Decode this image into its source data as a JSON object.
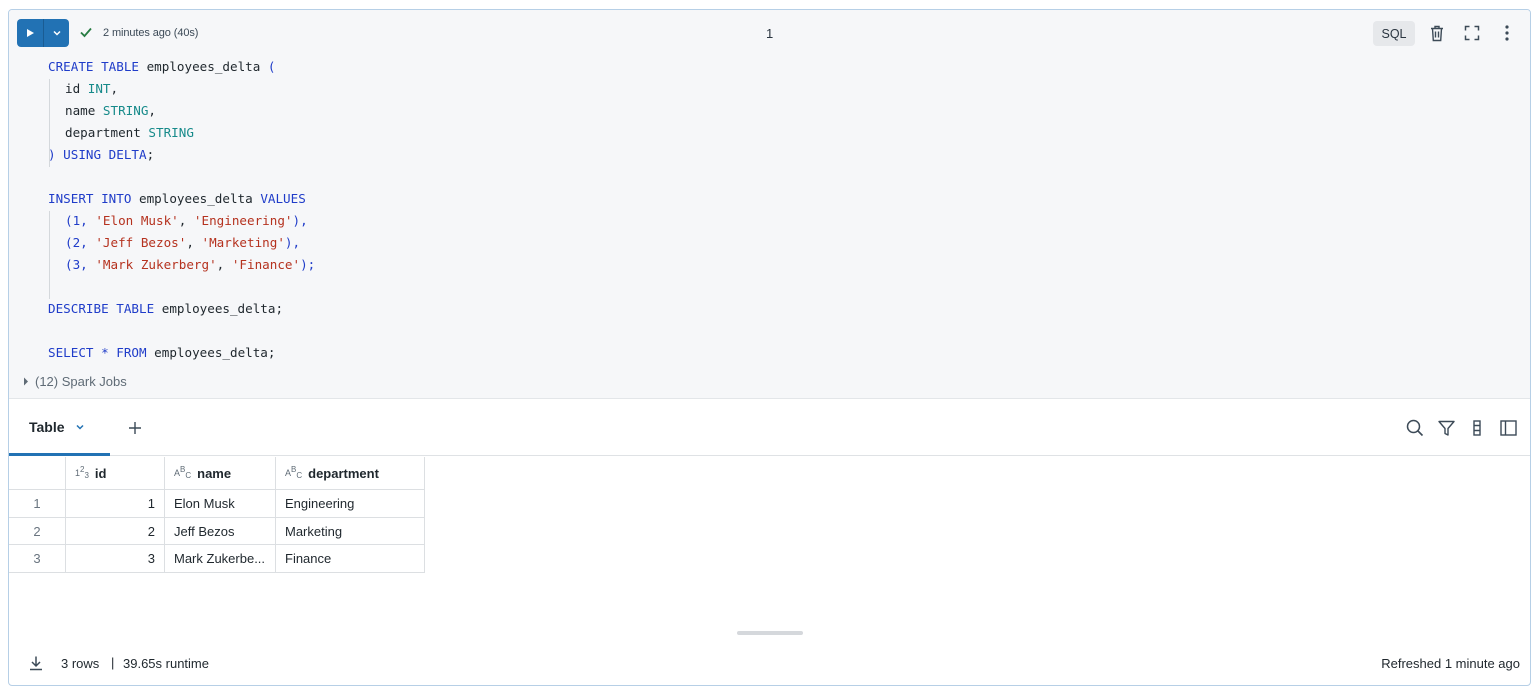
{
  "header": {
    "status_text": "2 minutes ago (40s)",
    "cell_index": "1",
    "language": "SQL"
  },
  "code": {
    "l1": {
      "a": "CREATE TABLE",
      "b": " employees_delta ",
      "c": "("
    },
    "l2": {
      "a": "id ",
      "b": "INT",
      "c": ","
    },
    "l3": {
      "a": "name ",
      "b": "STRING",
      "c": ","
    },
    "l4": {
      "a": "department ",
      "b": "STRING"
    },
    "l5": {
      "a": ")",
      "b": " USING DELTA",
      "c": ";"
    },
    "l6": {
      "a": "INSERT INTO",
      "b": " employees_delta ",
      "c": "VALUES"
    },
    "l7": {
      "a": "(1, ",
      "b": "'Elon Musk'",
      "c": ", ",
      "d": "'Engineering'",
      "e": "),"
    },
    "l8": {
      "a": "(2, ",
      "b": "'Jeff Bezos'",
      "c": ", ",
      "d": "'Marketing'",
      "e": "),"
    },
    "l9": {
      "a": "(3, ",
      "b": "'Mark Zukerberg'",
      "c": ", ",
      "d": "'Finance'",
      "e": ");"
    },
    "l10": {
      "a": "DESCRIBE TABLE",
      "b": " employees_delta;"
    },
    "l11": {
      "a": "SELECT * FROM",
      "b": " employees_delta;"
    }
  },
  "spark_jobs": "(12) Spark Jobs",
  "result_tab": {
    "label": "Table"
  },
  "grid": {
    "columns": [
      {
        "type": "123",
        "name": "id"
      },
      {
        "type": "ABC",
        "name": "name"
      },
      {
        "type": "ABC",
        "name": "department"
      }
    ],
    "rows": [
      {
        "index": "1",
        "id": "1",
        "name": "Elon Musk",
        "department": "Engineering"
      },
      {
        "index": "2",
        "id": "2",
        "name": "Jeff Bezos",
        "department": "Marketing"
      },
      {
        "index": "3",
        "id": "3",
        "name": "Mark Zukerbe...",
        "department": "Finance"
      }
    ]
  },
  "footer": {
    "rows": "3 rows",
    "separator": "|",
    "runtime": "39.65s runtime",
    "refreshed": "Refreshed 1 minute ago"
  },
  "colors": {
    "accent": "#2272b4",
    "success": "#277c43",
    "keyword": "#1f3cc9",
    "type": "#168a8a",
    "string": "#b5321f"
  }
}
